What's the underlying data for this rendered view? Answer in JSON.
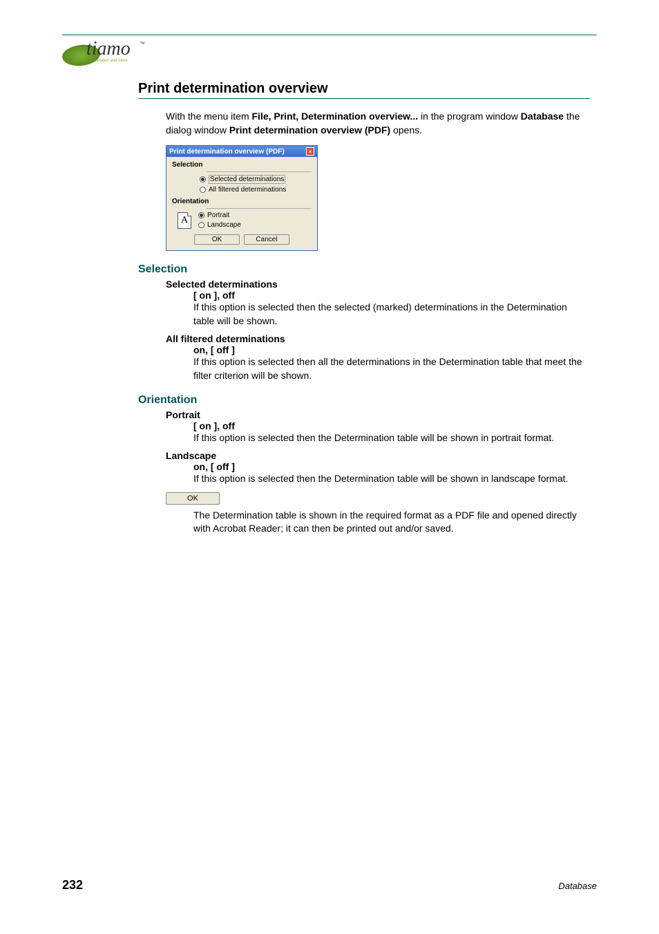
{
  "logo": {
    "text": "tiamo",
    "tm": "™",
    "tagline": "titration and more"
  },
  "h1": "Print determination overview",
  "intro": {
    "pre": "With the menu item ",
    "menuitem": "File, Print, Determination overview...",
    "mid": " in the program window ",
    "win": "Database",
    "mid2": " the dialog window ",
    "dlgname": "Print determination overview (PDF)",
    "post": " opens."
  },
  "dialog": {
    "title": "Print determination overview (PDF)",
    "sel_legend": "Selection",
    "sel_opt1": "Selected determinations",
    "sel_opt2": "All filtered determinations",
    "ori_legend": "Orientation",
    "ori_icon_letter": "A",
    "ori_opt1": "Portrait",
    "ori_opt2": "Landscape",
    "ok": "OK",
    "cancel": "Cancel"
  },
  "selection": {
    "heading": "Selection",
    "item1": {
      "term": "Selected determinations",
      "state": "[ on ], off",
      "desc": "If this option is selected then the selected (marked) determinations in the Determination table will be shown."
    },
    "item2": {
      "term": "All filtered determinations",
      "state": "on, [ off ]",
      "desc": "If this option is selected then all the determinations in the Determination table that meet the filter criterion will be shown."
    }
  },
  "orientation": {
    "heading": "Orientation",
    "item1": {
      "term": "Portrait",
      "state": "[ on ], off",
      "desc": "If this option is selected then the Determination table will be shown in portrait format."
    },
    "item2": {
      "term": "Landscape",
      "state": "on, [ off ]",
      "desc": "If this option is selected then the Determination table will be shown in landscape format."
    }
  },
  "okbtn": {
    "label": "OK",
    "desc": "The Determination table is shown in the required format as a PDF file and opened directly with Acrobat Reader; it can then be printed out and/or saved."
  },
  "footer": {
    "page": "232",
    "section": "Database"
  }
}
